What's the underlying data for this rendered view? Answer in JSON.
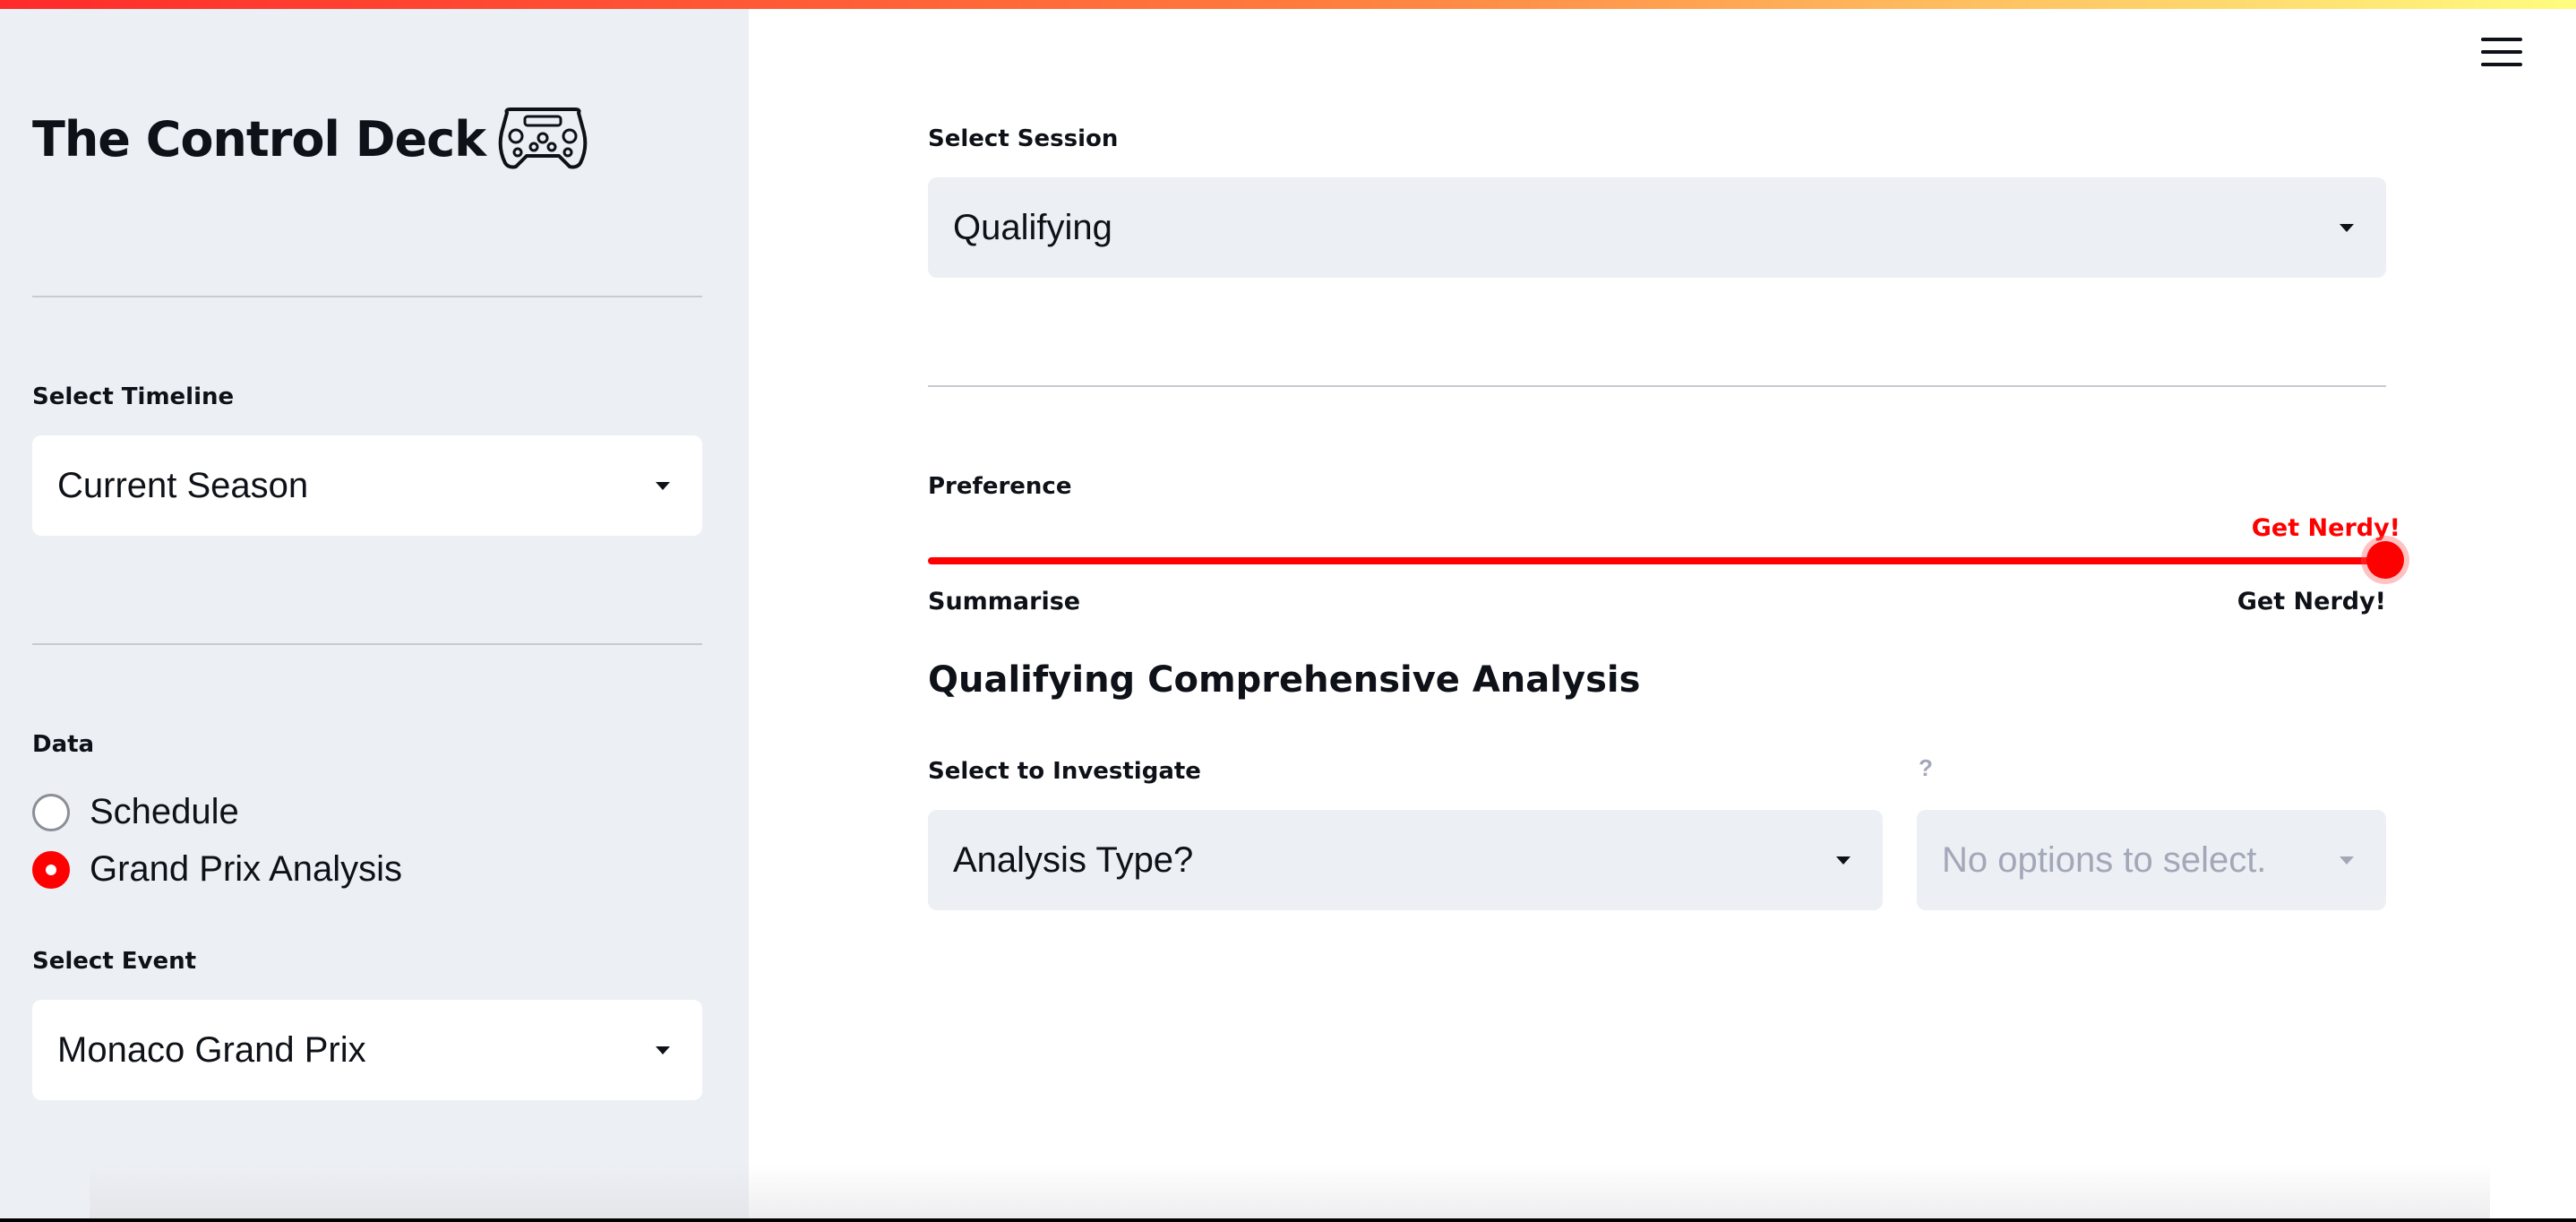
{
  "sidebar": {
    "app_title": "The Control Deck",
    "timeline": {
      "label": "Select Timeline",
      "value": "Current Season"
    },
    "data": {
      "label": "Data",
      "options": [
        {
          "label": "Schedule",
          "selected": false
        },
        {
          "label": "Grand Prix Analysis",
          "selected": true
        }
      ]
    },
    "event": {
      "label": "Select Event",
      "value": "Monaco Grand Prix"
    }
  },
  "main": {
    "session": {
      "label": "Select Session",
      "value": "Qualifying"
    },
    "preference": {
      "label": "Preference",
      "current": "Get Nerdy!",
      "min_label": "Summarise",
      "max_label": "Get Nerdy!",
      "position_fraction": 1.0
    },
    "heading": "Qualifying Comprehensive Analysis",
    "investigate": {
      "label": "Select to Investigate",
      "value": "Analysis Type?"
    },
    "secondary": {
      "label": "?",
      "value": "No options to select."
    }
  },
  "colors": {
    "accent": "#ff0000",
    "sidebar_bg": "#eceff4",
    "input_bg": "#eceff4",
    "text": "#0e1117"
  },
  "icons": {
    "logo": "steering-wheel-icon",
    "menu": "hamburger-menu-icon",
    "dropdown": "chevron-down-icon"
  }
}
